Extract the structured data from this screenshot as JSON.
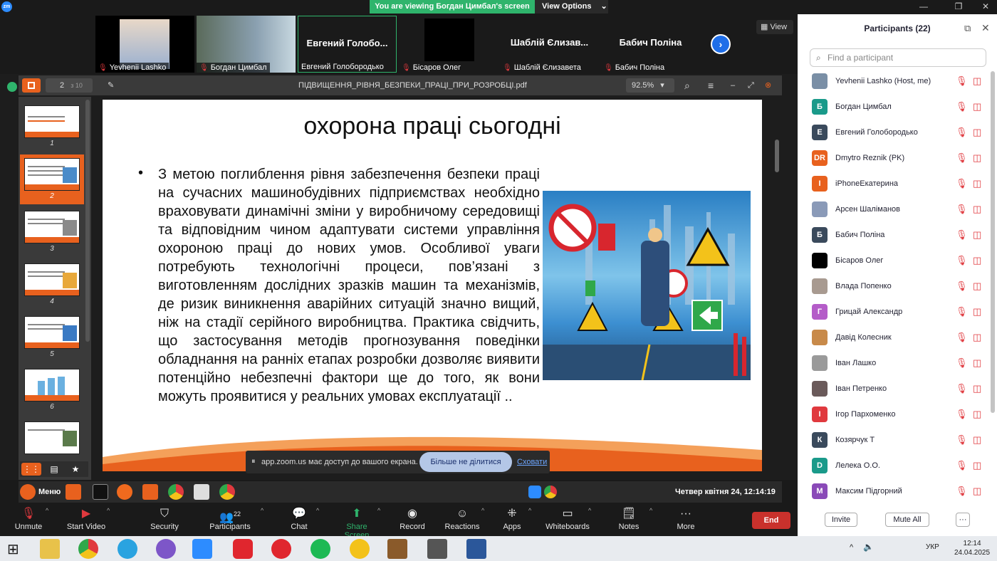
{
  "top": {
    "viewing_banner": "You are viewing Богдан Цимбал's screen",
    "view_options": "View Options",
    "view_label": "View"
  },
  "videos": [
    {
      "name": "Yevhenii Lashko",
      "big": ""
    },
    {
      "name": "Богдан Цимбал",
      "big": ""
    },
    {
      "name": "Евгений Голобородько",
      "big": "Евгений  Голобо..."
    },
    {
      "name": "Бісаров Олег",
      "big": ""
    },
    {
      "name": "Шаблій Єлизавета",
      "big": "Шаблій Єлизав..."
    },
    {
      "name": "Бабич Поліна",
      "big": "Бабич Поліна"
    }
  ],
  "pdf": {
    "filename": "ПІДВИЩЕННЯ_РІВНЯ_БЕЗПЕКИ_ПРАЦІ_ПРИ_РОЗРОБЦІ.pdf",
    "page": "2",
    "page_total": "з 10",
    "zoom": "92.5%",
    "thumb_numbers": [
      "1",
      "2",
      "3",
      "4",
      "5",
      "6"
    ]
  },
  "slide": {
    "title": "охорона праці сьогодні",
    "bullet": "•",
    "body": "З метою поглиблення рівня забезпечення безпеки праці на сучасних машинобудівних підприємствах необхідно враховувати динамічні зміни у виробничому середовищі та відповідним чином адаптувати системи управління охороною праці до нових умов. Особливої уваги потребують технологічні процеси, пов’язані з виготовленням дослідних зразків машин та механізмів, де ризик виникнення аварійних ситуацій значно вищий, ніж на стадії серійного виробництва. Практика свідчить, що застосування методів прогнозування поведінки обладнання на ранніх етапах розробки дозволяє виявити потенційно небезпечні фактори ще до того, як вони можуть проявитися у реальних умовах експлуатації .."
  },
  "share_notice": {
    "text": "app.zoom.us має доступ до вашого екрана.",
    "stop": "Більше не ділитися",
    "hide": "Сховати"
  },
  "vm_taskbar": {
    "menu": "Меню",
    "clock": "Четвер квітня 24, 12:14:19"
  },
  "toolbar": {
    "unmute": "Unmute",
    "start_video": "Start Video",
    "security": "Security",
    "participants": "Participants",
    "participants_count": "22",
    "chat": "Chat",
    "share_screen": "Share Screen",
    "record": "Record",
    "reactions": "Reactions",
    "apps": "Apps",
    "whiteboards": "Whiteboards",
    "notes": "Notes",
    "more": "More",
    "end": "End"
  },
  "panel": {
    "title": "Participants (22)",
    "search_placeholder": "Find a participant",
    "invite": "Invite",
    "mute_all": "Mute All",
    "more": "···",
    "people": [
      {
        "name": "Yevhenii Lashko (Host, me)",
        "initial": "",
        "color": "#7a8fa6"
      },
      {
        "name": "Богдан Цимбал",
        "initial": "Б",
        "color": "#1a9a8a"
      },
      {
        "name": "Евгений Голобородько",
        "initial": "Е",
        "color": "#3a4a5c"
      },
      {
        "name": "Dmytro Reznik (PK)",
        "initial": "DR",
        "color": "#e8611e"
      },
      {
        "name": "iPhoneЕкатерина",
        "initial": "I",
        "color": "#e8611e"
      },
      {
        "name": "Арсен Шаліманов",
        "initial": "",
        "color": "#8a9ab8"
      },
      {
        "name": "Бабич Поліна",
        "initial": "Б",
        "color": "#3a4a5c"
      },
      {
        "name": "Бісаров Олег",
        "initial": "",
        "color": "#000000"
      },
      {
        "name": "Влада Попенко",
        "initial": "",
        "color": "#a89a90"
      },
      {
        "name": "Грицай Александр",
        "initial": "Г",
        "color": "#b45cc8"
      },
      {
        "name": "Давід Колесник",
        "initial": "",
        "color": "#c88a4a"
      },
      {
        "name": "Іван Лашко",
        "initial": "",
        "color": "#9a9a9a"
      },
      {
        "name": "Іван Петренко",
        "initial": "",
        "color": "#6a5a5a"
      },
      {
        "name": "Ігор Пархоменко",
        "initial": "I",
        "color": "#e0393e"
      },
      {
        "name": "Козярчук Т",
        "initial": "К",
        "color": "#3a4a5c"
      },
      {
        "name": "Лелека О.О.",
        "initial": "D",
        "color": "#1a9a8a"
      },
      {
        "name": "Максим Підгорний",
        "initial": "М",
        "color": "#8a4ab8"
      }
    ]
  },
  "win": {
    "lang": "УКР",
    "time": "12:14",
    "date": "24.04.2025"
  }
}
